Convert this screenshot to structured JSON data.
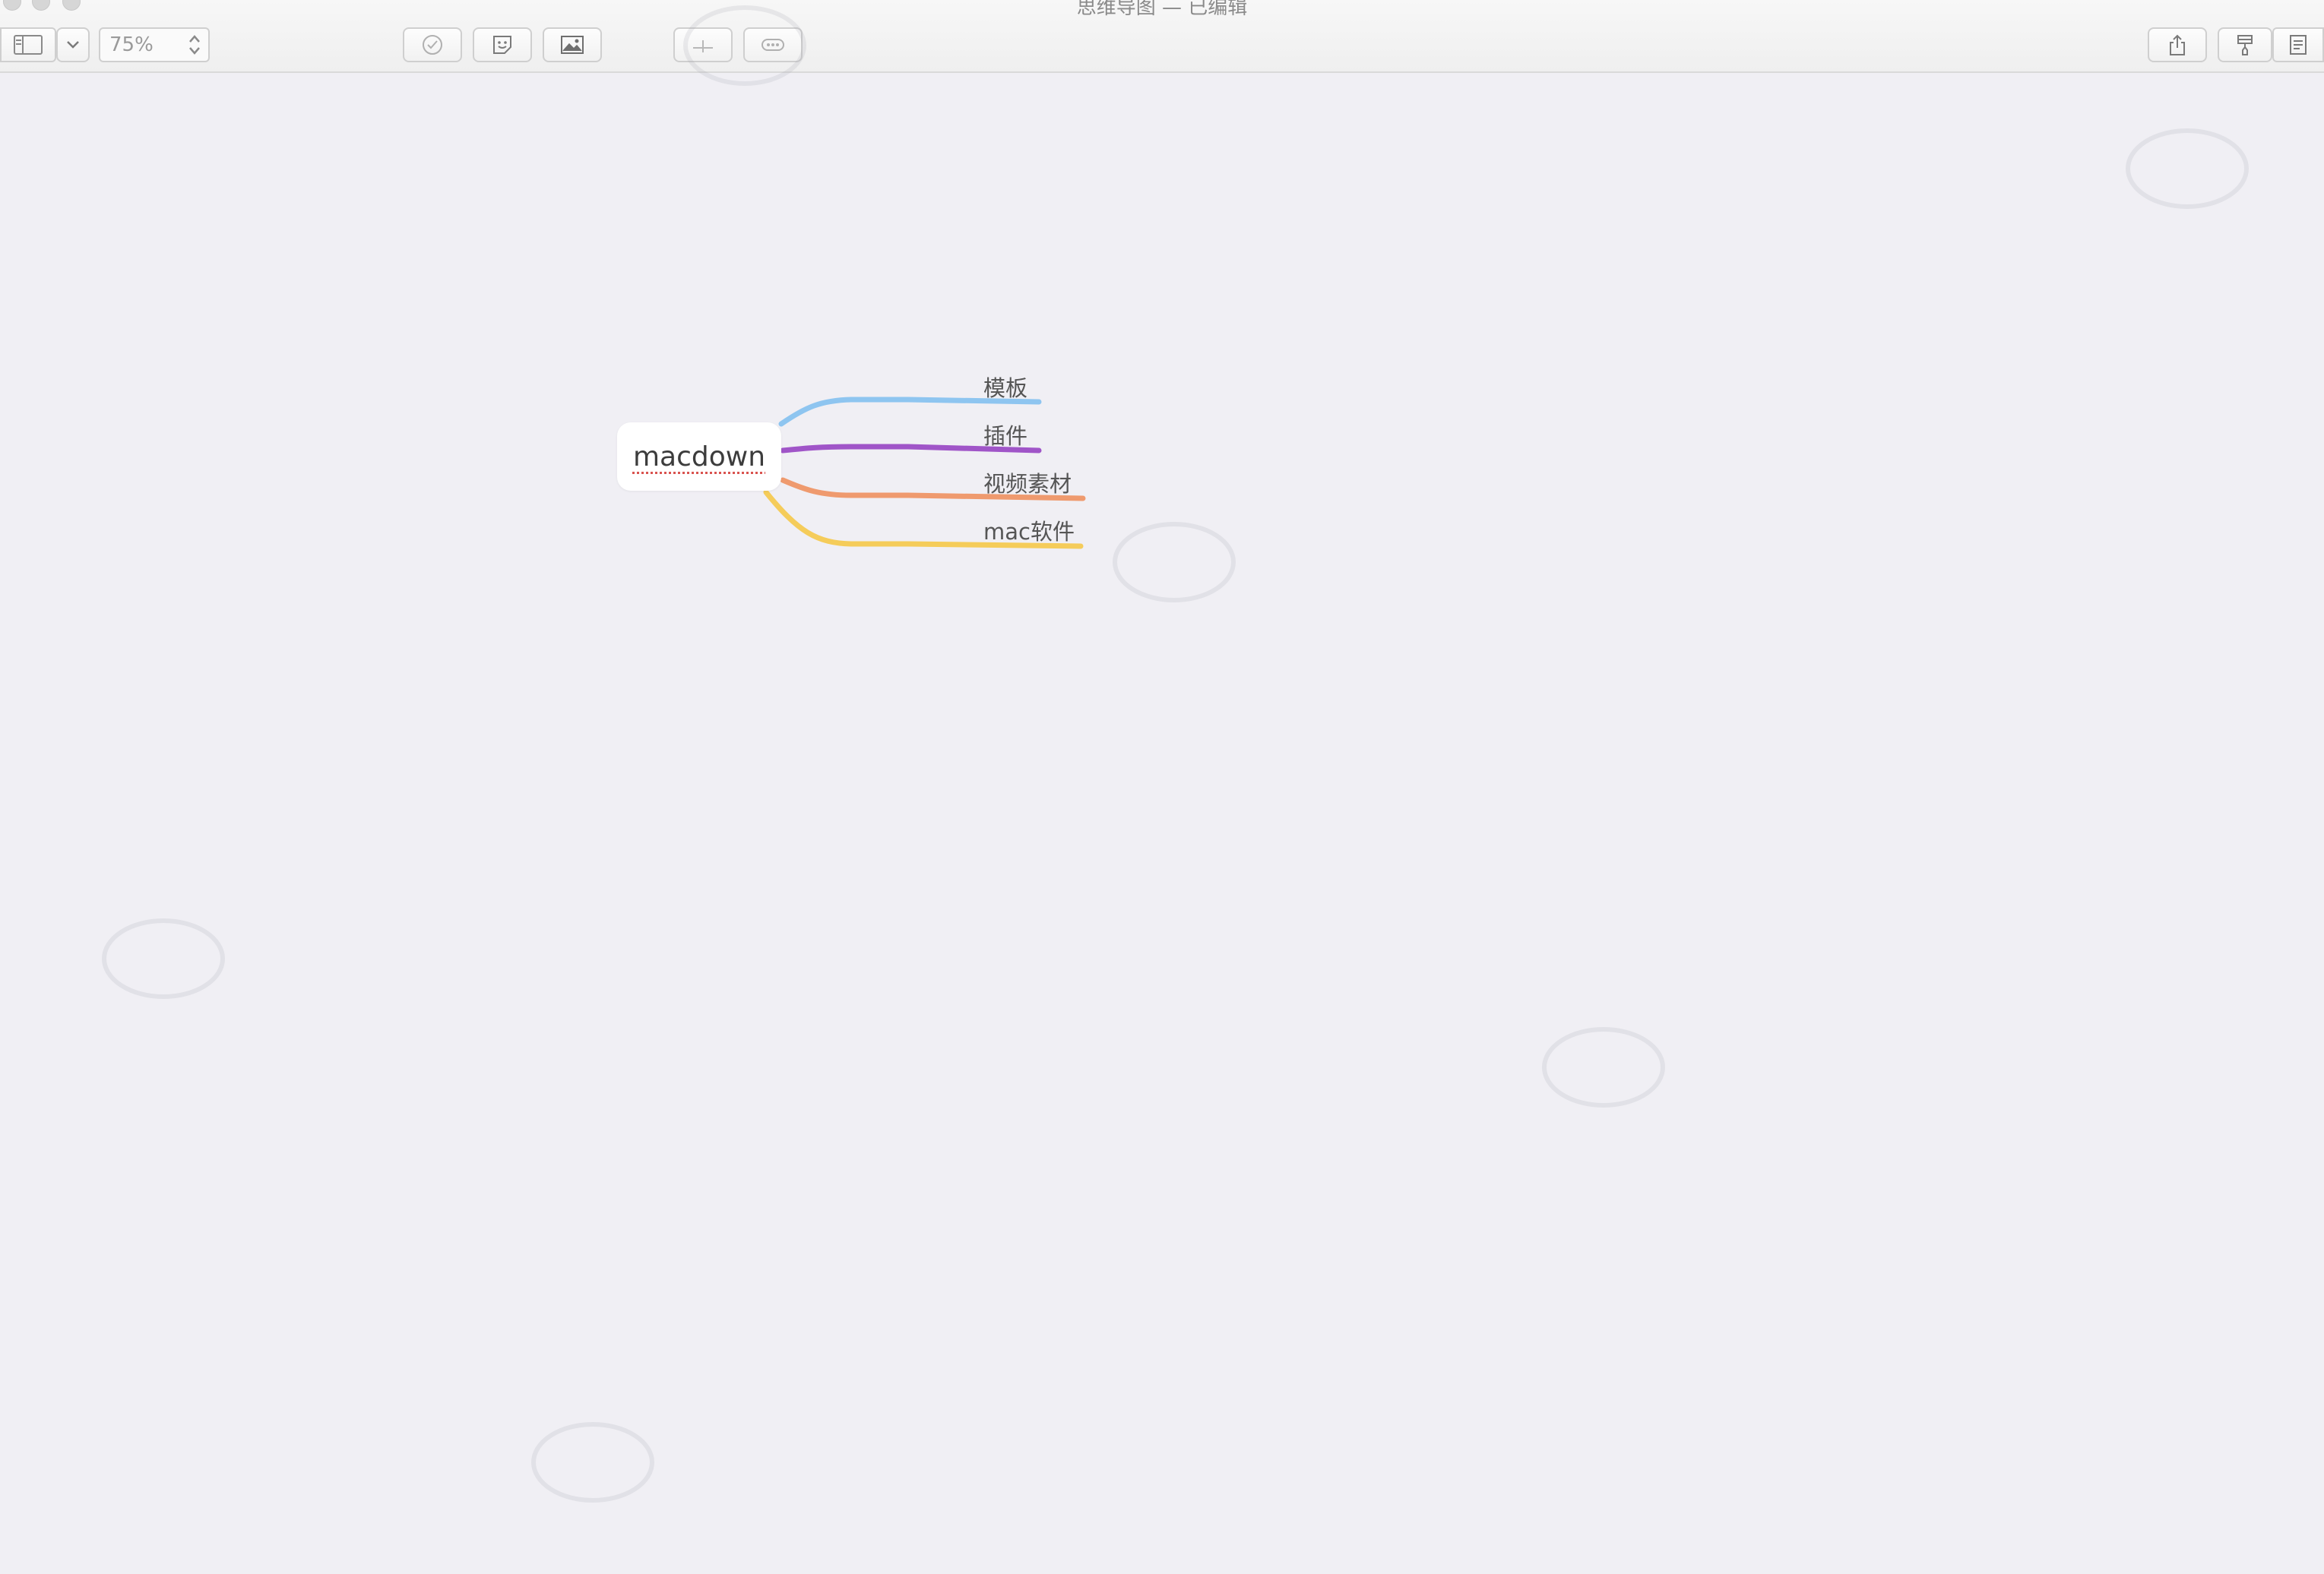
{
  "window": {
    "title": "思维导图 — 已编辑"
  },
  "toolbar": {
    "zoom_value": "75%"
  },
  "mindmap": {
    "root": {
      "label": "macdown",
      "color": "#3c3c3c"
    },
    "topics": [
      {
        "label": "模板",
        "color": "#8ec5f0"
      },
      {
        "label": "插件",
        "color": "#a055c8"
      },
      {
        "label": "视频素材",
        "color": "#ef9a6e"
      },
      {
        "label": "mac软件",
        "color": "#f5cc5a"
      }
    ]
  },
  "icons": {
    "sidebar": "sidebar-toggle-icon",
    "dropdown": "chevron-down-icon",
    "task": "checkmark-circle-icon",
    "sticker": "sticker-icon",
    "image": "image-icon",
    "relationship": "relationship-icon",
    "more": "more-icon",
    "share": "share-icon",
    "format": "format-brush-icon",
    "outline": "outline-icon"
  }
}
